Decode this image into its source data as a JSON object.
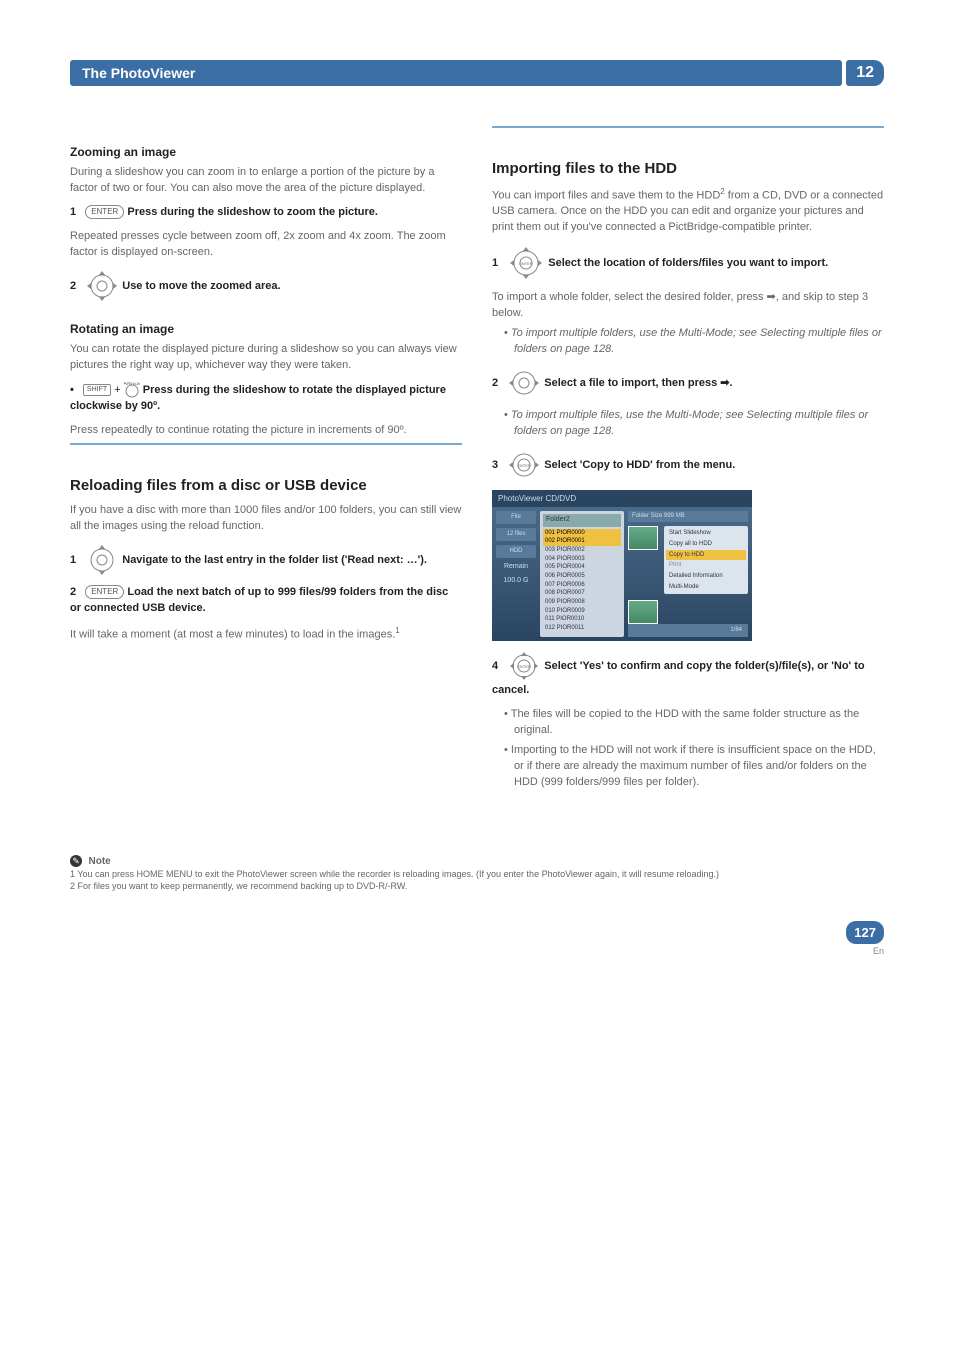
{
  "header": {
    "title": "The PhotoViewer",
    "chapter": "12"
  },
  "left": {
    "zoom": {
      "heading": "Zooming an image",
      "intro": "During a slideshow you can zoom in to enlarge a portion of the picture by a factor of two or four. You can also move the area of the picture displayed.",
      "step1_num": "1",
      "step1_btn": "ENTER",
      "step1_text": "Press during the slideshow to zoom the picture.",
      "step1_after": "Repeated presses cycle between zoom off, 2x zoom and 4x zoom. The zoom factor is displayed on-screen.",
      "step2_num": "2",
      "step2_text": "Use to move the zoomed area."
    },
    "rotate": {
      "heading": "Rotating an image",
      "intro": "You can rotate the displayed picture during a slideshow so you can always view pictures the right way up, whichever way they were taken.",
      "bullet_shift": "SHIFT",
      "bullet_angle": "ANGLE",
      "bullet_text": "Press during the slideshow to rotate the displayed picture clockwise by 90º.",
      "after": "Press repeatedly to continue rotating the picture in increments of 90º."
    },
    "reload": {
      "heading": "Reloading files from a disc or USB device",
      "intro": "If you have a disc with more than 1000 files and/or 100 folders, you can still view all the images using the reload function.",
      "step1_num": "1",
      "step1_text": "Navigate to the last entry in the folder list ('Read next: …').",
      "step2_num": "2",
      "step2_btn": "ENTER",
      "step2_text": "Load the next batch of up to 999 files/99 folders from the disc or connected USB device.",
      "step2_after_a": "It will take a moment (at most a few minutes) to load in the images.",
      "step2_sup": "1"
    }
  },
  "right": {
    "import": {
      "heading": "Importing files to the HDD",
      "intro_a": "You can import files and save them to the HDD",
      "intro_sup": "2",
      "intro_b": " from a CD, DVD or a connected USB camera. Once on the HDD you can edit and organize your pictures and print them out if you've connected a PictBridge-compatible printer.",
      "step1_num": "1",
      "step1_text": "Select the location of folders/files you want to import.",
      "step1_after": "To import a whole folder, select the desired folder, press ➡, and skip to step 3 below.",
      "step1_bullet": "To import multiple folders, use the Multi-Mode; see Selecting multiple files or folders on page 128.",
      "step2_num": "2",
      "step2_text": "Select a file to import, then press ➡.",
      "step2_bullet": "To import multiple files, use the Multi-Mode; see Selecting multiple files or folders on page 128.",
      "step3_num": "3",
      "step3_text": "Select 'Copy to HDD' from the menu.",
      "step4_num": "4",
      "step4_text": "Select 'Yes' to confirm and copy the folder(s)/file(s), or 'No' to cancel.",
      "step4_bullet1": "The files will be copied to the HDD with the same folder structure as the original.",
      "step4_bullet2": "Importing to the HDD will not work if there is insufficient space on the HDD, or if there are already the maximum number of files and/or folders on the HDD (999 folders/999 files per folder)."
    },
    "screenshot": {
      "title": "PhotoViewer  CD/DVD",
      "folder_tab": "Folder2",
      "file_tab": "File",
      "folder_size": "Folder Size 999 MB",
      "sidebar_file": "File",
      "sidebar_files": "12 files",
      "sidebar_hdd": "HDD",
      "sidebar_remain": "Remain",
      "sidebar_remain_val": "100.0 G",
      "items": [
        "001 PIOR0000",
        "002 PIOR0001",
        "003 PIOR0002",
        "004 PIOR0003",
        "005 PIOR0004",
        "006 PIOR0005",
        "007 PIOR0006",
        "008 PIOR0007",
        "009 PIOR0008",
        "010 PIOR0009",
        "011 PIOR0010",
        "012 PIOR0011"
      ],
      "menu": {
        "start": "Start Slideshow",
        "copyall": "Copy all to HDD",
        "copy": "Copy to HDD",
        "print": "Print",
        "detail": "Detailed Information",
        "multi": "Multi-Mode"
      },
      "counter": "1/84"
    }
  },
  "note": {
    "label": "Note",
    "n1": "1 You can press HOME MENU to exit the PhotoViewer screen while the recorder is reloading images. (If you enter the PhotoViewer again, it will resume reloading.)",
    "n2": "2 For files you want to keep permanently, we recommend backing up to DVD-R/-RW."
  },
  "page": {
    "num": "127",
    "lang": "En"
  },
  "nav_enter": "ENTER"
}
